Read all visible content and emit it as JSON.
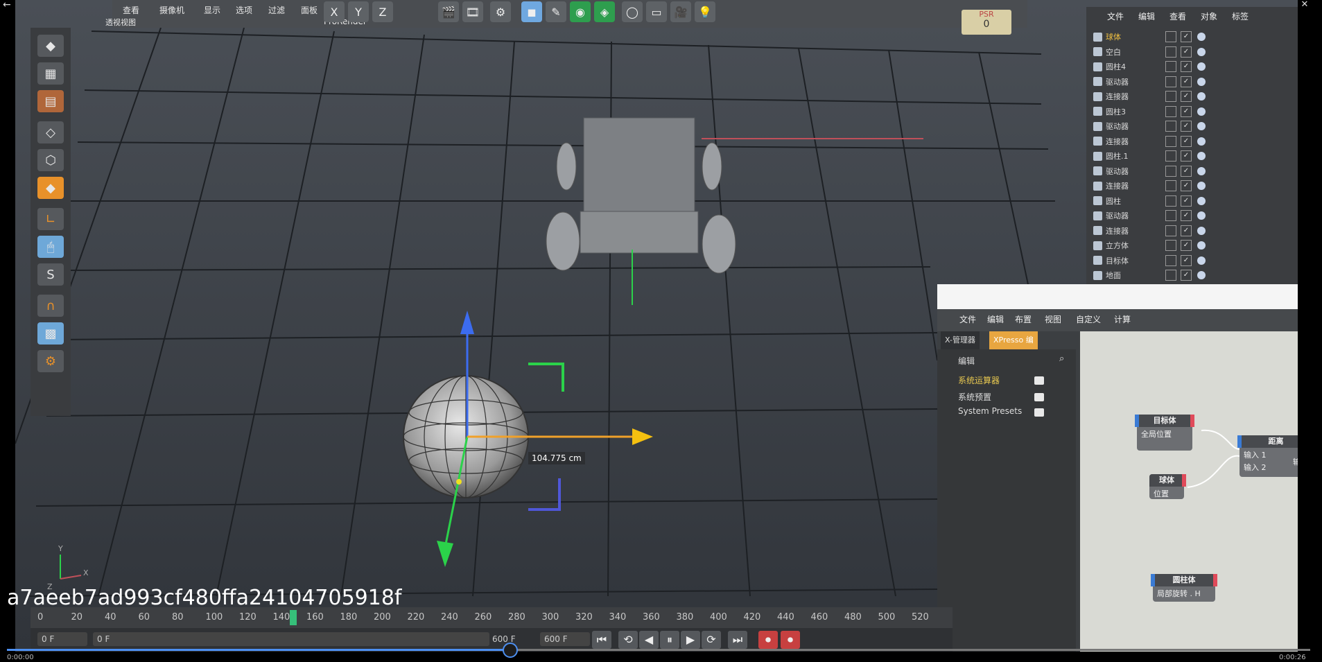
{
  "window_controls": {
    "back": "←",
    "minimize": "—",
    "restore": "❐",
    "close": "✕"
  },
  "video": {
    "overlay_id": "a7aeeb7ad993cf480ffa24104705918f",
    "progress_fraction": 0.385
  },
  "menubar": {
    "items": [
      "查看",
      "摄像机",
      "显示",
      "选项",
      "过滤",
      "面板",
      "ProRender"
    ],
    "viewport_label": "透视视图",
    "axis_buttons": [
      "X",
      "Y",
      "Z"
    ],
    "psr_label": "PSR",
    "psr_value": "0"
  },
  "left_tools": {
    "icons": [
      "cube",
      "checker-cube",
      "wedge",
      "cube-outline",
      "cube-alt",
      "cube-orange",
      "corner-L",
      "mouse",
      "S",
      "magnet",
      "grid-lock",
      "gear-lock"
    ],
    "s_label": "S"
  },
  "viewport": {
    "distance_readout": "104.775 cm",
    "axis_labels": {
      "y": "Y",
      "x": "X",
      "z": "Z"
    }
  },
  "object_manager": {
    "menu": [
      "文件",
      "编辑",
      "查看",
      "对象",
      "标签"
    ],
    "rows": [
      {
        "label": "球体",
        "highlight": true
      },
      {
        "label": "空白",
        "highlight": false
      },
      {
        "label": "圆柱4",
        "highlight": false
      },
      {
        "label": "驱动器",
        "highlight": false
      },
      {
        "label": "连接器",
        "highlight": false
      },
      {
        "label": "圆柱3",
        "highlight": false
      },
      {
        "label": "驱动器",
        "highlight": false
      },
      {
        "label": "连接器",
        "highlight": false
      },
      {
        "label": "圆柱.1",
        "highlight": false
      },
      {
        "label": "驱动器",
        "highlight": false
      },
      {
        "label": "连接器",
        "highlight": false
      },
      {
        "label": "圆柱",
        "highlight": false
      },
      {
        "label": "驱动器",
        "highlight": false
      },
      {
        "label": "连接器",
        "highlight": false
      },
      {
        "label": "立方体",
        "highlight": false
      },
      {
        "label": "目标体",
        "highlight": false
      },
      {
        "label": "地面",
        "highlight": false
      }
    ]
  },
  "xpresso": {
    "menu": [
      "文件",
      "编辑",
      "布置",
      "视图",
      "自定义",
      "计算"
    ],
    "tabs": [
      "X-管理器",
      "XPresso 编"
    ],
    "panel_header": "编辑",
    "tree": [
      "系统运算器",
      "系统预置",
      "System Presets"
    ],
    "nodes": [
      {
        "title": "目标体",
        "port": "全局位置"
      },
      {
        "title": "距离",
        "port": "输入 1",
        "port2": "输入 2",
        "out": "输出"
      },
      {
        "title": "球体",
        "port": "位置"
      },
      {
        "title": "圆柱体",
        "port": "局部旋转 . H"
      }
    ]
  },
  "timeline": {
    "ticks": [
      "0",
      "20",
      "40",
      "60",
      "80",
      "100",
      "120",
      "140",
      "160",
      "180",
      "200",
      "220",
      "240",
      "260",
      "280",
      "300",
      "320",
      "340",
      "360",
      "380",
      "400",
      "420",
      "440",
      "460",
      "480",
      "500",
      "520"
    ],
    "start_field": "0 F",
    "current_field": "0 F",
    "end_field_a": "600 F",
    "end_field_b": "600 F",
    "playhead_frame": 150
  },
  "transport": {
    "buttons": [
      "⏮",
      "⟲",
      "◀",
      "⏸",
      "▶",
      "⟳",
      "⏭"
    ]
  },
  "time_start": "0:00:00",
  "time_end": "0:00:26"
}
